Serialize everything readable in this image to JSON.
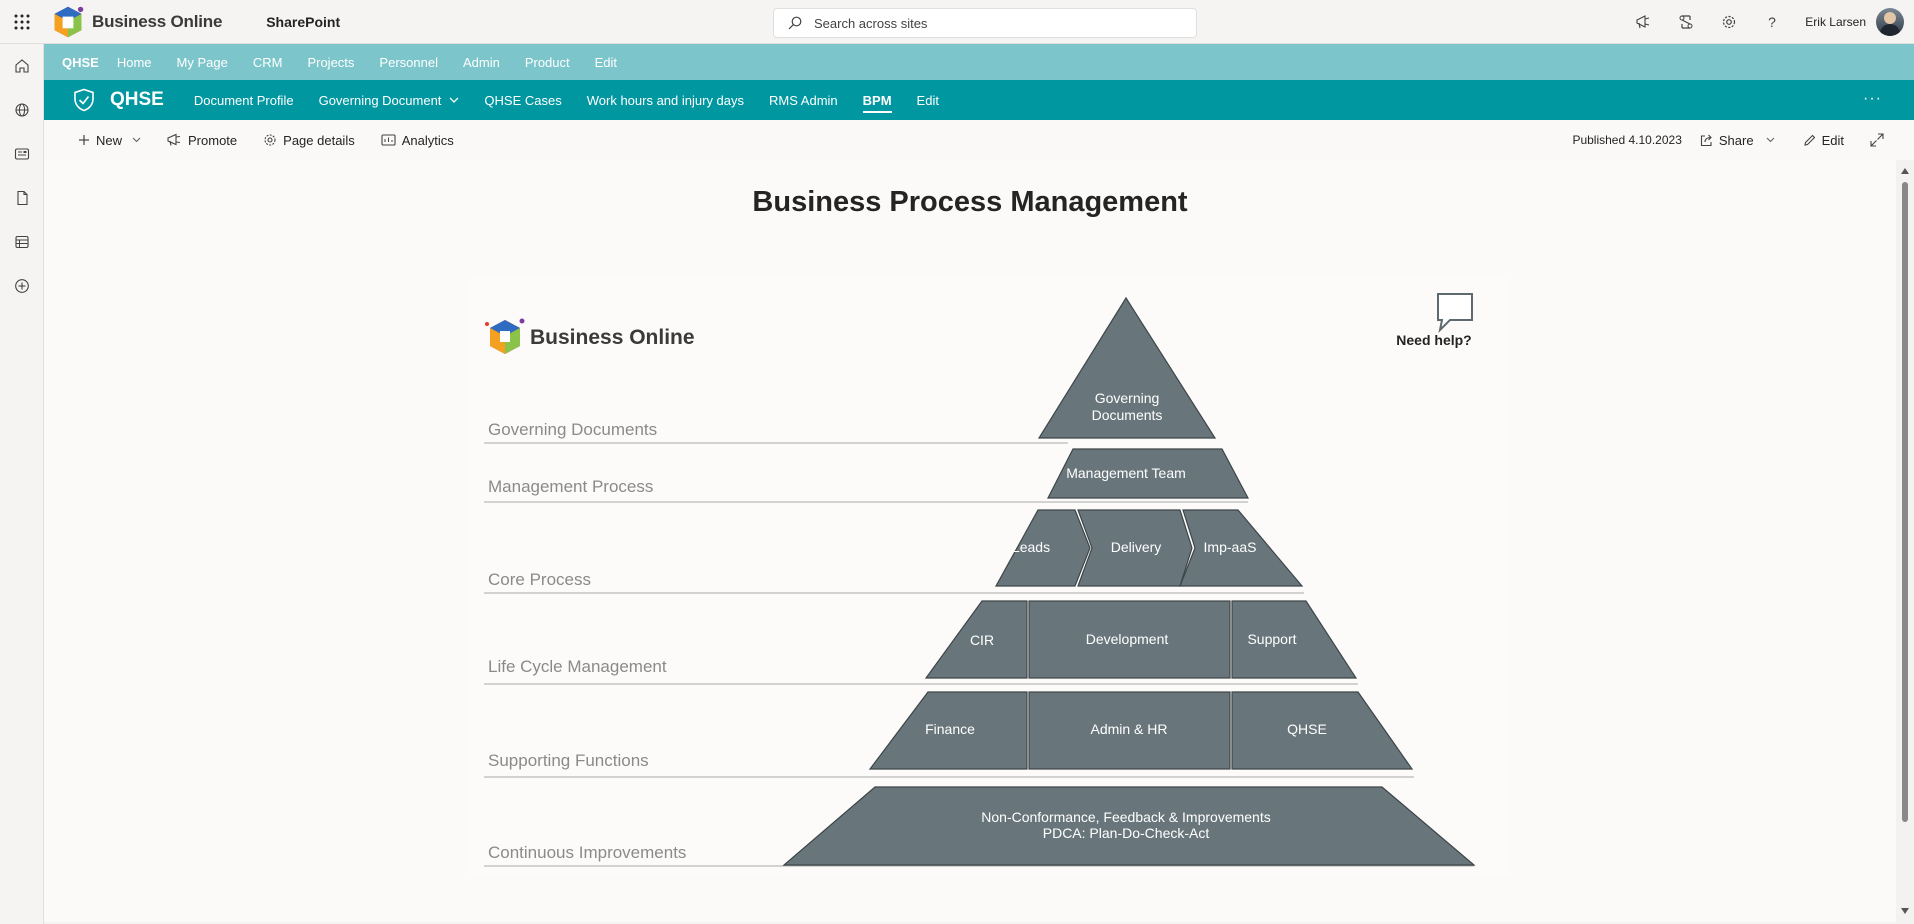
{
  "suitebar": {
    "brand": "Business Online",
    "app_name": "SharePoint",
    "search_placeholder": "Search across sites",
    "user_name": "Erik Larsen"
  },
  "hubnav": {
    "items": [
      "QHSE",
      "Home",
      "My Page",
      "CRM",
      "Projects",
      "Personnel",
      "Admin",
      "Product",
      "Edit"
    ]
  },
  "site": {
    "title": "QHSE",
    "nav": [
      "Document Profile",
      "Governing Document",
      "QHSE Cases",
      "Work hours and injury days",
      "RMS Admin",
      "BPM",
      "Edit"
    ],
    "active": "BPM"
  },
  "commandbar": {
    "new_label": "New",
    "promote_label": "Promote",
    "page_details_label": "Page details",
    "analytics_label": "Analytics",
    "published_label": "Published 4.10.2023",
    "share_label": "Share",
    "edit_label": "Edit"
  },
  "page": {
    "title": "Business Process Management"
  },
  "bpm": {
    "logo_text": "Business Online",
    "help_label": "Need help?",
    "levels": {
      "governing": "Governing Documents",
      "management": "Management Process",
      "core": "Core Process",
      "lifecycle": "Life Cycle Management",
      "supporting": "Supporting Functions",
      "continuous": "Continuous Improvements"
    },
    "blocks": {
      "gov_line1": "Governing",
      "gov_line2": "Documents",
      "management_team": "Management Team",
      "leads": "Leads",
      "delivery": "Delivery",
      "impaas": "Imp-aaS",
      "cir": "CIR",
      "development": "Development",
      "support": "Support",
      "finance": "Finance",
      "admin_hr": "Admin & HR",
      "qhse": "QHSE",
      "ci_line1": "Non-Conformance, Feedback & Improvements",
      "ci_line2": "PDCA: Plan-Do-Check-Act"
    }
  },
  "colors": {
    "hub": "#7cc6cb",
    "site_header": "#0097a1",
    "block_fill": "#68767b",
    "level_text": "#8a8a8a"
  }
}
